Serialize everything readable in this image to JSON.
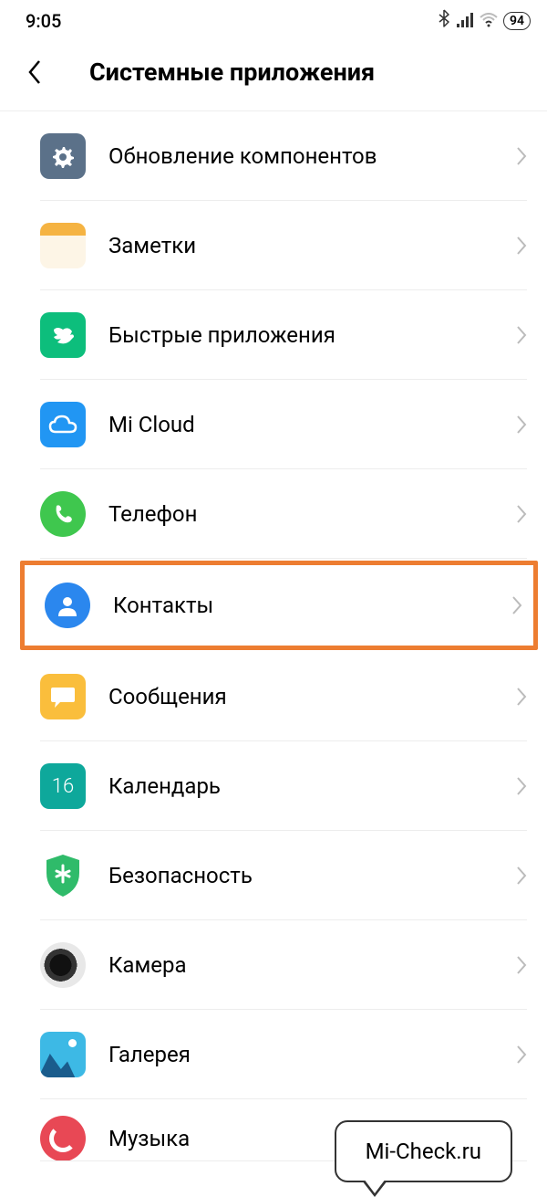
{
  "status": {
    "time": "9:05",
    "battery": "94"
  },
  "header": {
    "title": "Системные приложения"
  },
  "items": [
    {
      "label": "Обновление компонентов",
      "icon": "updates",
      "highlighted": false
    },
    {
      "label": "Заметки",
      "icon": "notes",
      "highlighted": false
    },
    {
      "label": "Быстрые приложения",
      "icon": "quickapps",
      "highlighted": false
    },
    {
      "label": "Mi Cloud",
      "icon": "micloud",
      "highlighted": false
    },
    {
      "label": "Телефон",
      "icon": "phone",
      "highlighted": false,
      "round": true
    },
    {
      "label": "Контакты",
      "icon": "contacts",
      "highlighted": true,
      "round": true
    },
    {
      "label": "Сообщения",
      "icon": "messages",
      "highlighted": false
    },
    {
      "label": "Календарь",
      "icon": "calendar",
      "highlighted": false,
      "day": "16"
    },
    {
      "label": "Безопасность",
      "icon": "security",
      "highlighted": false
    },
    {
      "label": "Камера",
      "icon": "camera",
      "highlighted": false,
      "round": true
    },
    {
      "label": "Галерея",
      "icon": "gallery",
      "highlighted": false
    },
    {
      "label": "Музыка",
      "icon": "music",
      "highlighted": false,
      "round": true
    }
  ],
  "tooltip": {
    "text": "Mi-Check.ru"
  }
}
